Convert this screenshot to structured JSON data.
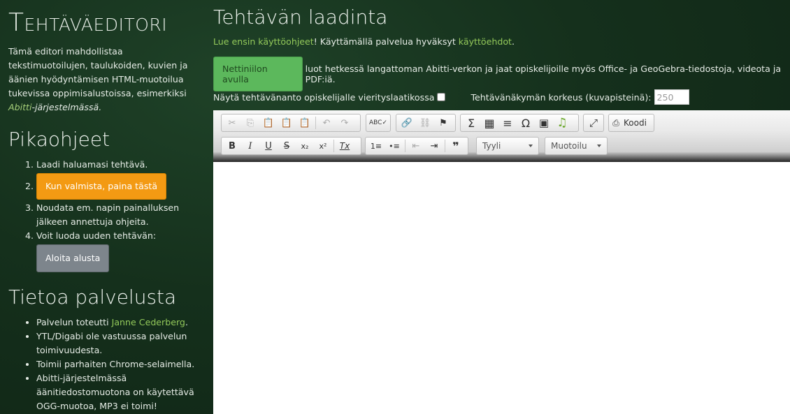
{
  "sidebar": {
    "app_title": "Tehtäväeditori",
    "intro_text": "Tämä editori mahdollistaa tekstimuotoilujen, taulukoiden, kuvien ja äänien hyödyntämisen HTML-muotoilua tukevissa oppimisalustoissa, esimerkiksi",
    "intro_link": "Abitti",
    "intro_suffix": "-järjestelmässä.",
    "quick_title": "Pikaohjeet",
    "quick_steps": {
      "step1": "Laadi haluamasi tehtävä.",
      "step2_button": "Kun valmista, paina tästä",
      "step3": "Noudata em. napin painalluksen jälkeen annettuja ohjeita.",
      "step4": "Voit luoda uuden tehtävän:",
      "step4_button": "Aloita alusta"
    },
    "about_title": "Tietoa palvelusta",
    "about_items": {
      "item1_prefix": "Palvelun toteutti",
      "item1_link": "Janne Cederberg",
      "item1_suffix": ".",
      "item2": "YTL/Digabi ole vastuussa palvelun toimivuudesta.",
      "item3": "Toimii parhaiten Chrome-selaimella.",
      "item4": "Abitti-järjestelmässä äänitiedostomuotona on käytettävä OGG-muotoa, MP3 ei toimi!"
    }
  },
  "main": {
    "title": "Tehtävän laadinta",
    "instructions_link": "Lue ensin käyttöohjeet",
    "instructions_mid": "! Käyttämällä palvelua hyväksyt ",
    "terms_link": "käyttöehdot",
    "terms_suffix": ".",
    "network_button": "Nettiniilon avulla",
    "network_text": "luot hetkessä langattoman Abitti-verkon ja jaat opiskelijoille myös Office- ja GeoGebra-tiedostoja, videota ja PDF:iä.",
    "scrollbox_label": "Näytä tehtävänanto opiskelijalle vierityslaatikossa",
    "height_label": "Tehtävänäkymän korkeus (kuvapisteinä):",
    "height_value": "250"
  },
  "toolbar": {
    "source_label": "Koodi",
    "style_combo": "Tyyli",
    "format_combo": "Muotoilu",
    "icons": {
      "cut": "✂",
      "copy": "⎘",
      "paste": "📋",
      "paste_text": "📋",
      "paste_word": "📋",
      "undo": "↶",
      "redo": "↷",
      "spellcheck": "ABC✓",
      "link": "🔗",
      "unlink": "⛓",
      "anchor": "⚑",
      "sum": "Σ",
      "table": "▦",
      "hr": "≡",
      "omega": "Ω",
      "image": "▣",
      "audio": "♫",
      "maximize": "⤢",
      "source": "⎙",
      "bold": "B",
      "italic": "I",
      "underline": "U",
      "strike": "S",
      "subscript": "x₂",
      "superscript": "x²",
      "removeformat": "Tx",
      "numlist": "1≡",
      "bulletlist": "•≡",
      "outdent": "⇤",
      "indent": "⇥",
      "blockquote": "❞"
    },
    "colors": {
      "audio": "#6aa82a",
      "orange": "#f39a13",
      "green": "#5cb85c",
      "link": "#93c95a"
    }
  }
}
